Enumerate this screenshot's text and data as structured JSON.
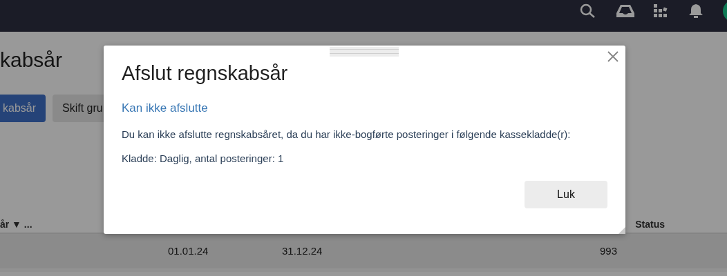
{
  "page": {
    "title": "kabsår",
    "buttons": [
      {
        "label": "kabsår",
        "kind": "primary"
      },
      {
        "label": "Skift gru",
        "kind": "secondary"
      }
    ],
    "table": {
      "columns": [
        {
          "label": "år ▼ ..."
        },
        {
          "label": "Status"
        }
      ],
      "rows": [
        {
          "start": "01.01.24",
          "end": "31.12.24",
          "number": "993"
        }
      ]
    }
  },
  "dialog": {
    "title": "Afslut regnskabsår",
    "subtitle": "Kan ikke afslutte",
    "message": "Du kan ikke afslutte regnskabsåret, da du har ikke-bogførte posteringer i følgende kassekladde(r):",
    "detail": "Kladde: Daglig, antal posteringer: 1",
    "close_button": "Luk"
  }
}
